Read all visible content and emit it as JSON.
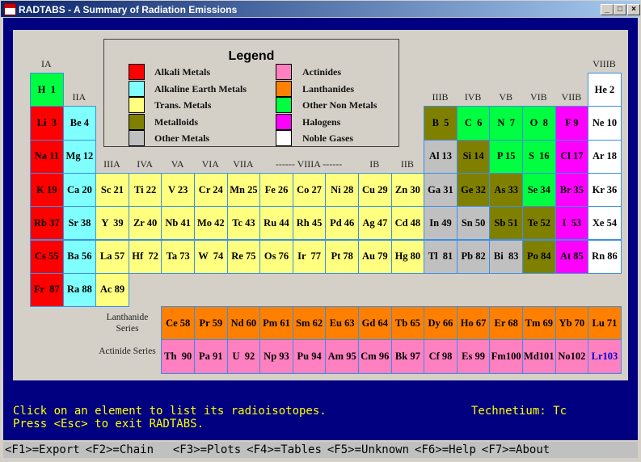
{
  "window": {
    "title": "RADTABS - A Summary of Radiation Emissions",
    "minimize": "_",
    "maximize": "□",
    "close": "×"
  },
  "colors": {
    "alkali": "#ff0000",
    "alkaline": "#80ffff",
    "trans": "#ffff80",
    "metalloid": "#808000",
    "other": "#c0c0c0",
    "noble": "#ffffff",
    "actinide": "#ff80c0",
    "lanthanide": "#ff8000",
    "nonmetal": "#00ff40",
    "halogen": "#ff00ff"
  },
  "legend": {
    "title": "Legend",
    "items": [
      {
        "label": "Alkali Metals",
        "cat": "alkali"
      },
      {
        "label": "Alkaline Earth Metals",
        "cat": "alkaline"
      },
      {
        "label": "Trans. Metals",
        "cat": "trans"
      },
      {
        "label": "Metalloids",
        "cat": "metalloid"
      },
      {
        "label": "Other Metals",
        "cat": "other"
      },
      {
        "label": "Actinides",
        "cat": "actinide"
      },
      {
        "label": "Lanthanides",
        "cat": "lanthanide"
      },
      {
        "label": "Other Non Metals",
        "cat": "nonmetal"
      },
      {
        "label": "Halogens",
        "cat": "halogen"
      },
      {
        "label": "Noble Gases",
        "cat": "noble"
      }
    ]
  },
  "groups": [
    "IA",
    "IIA",
    "IIIA",
    "IVA",
    "VA",
    "VIA",
    "VIIA",
    "------ VIIIA ------",
    "IB",
    "IIB",
    "IIIB",
    "IVB",
    "VB",
    "VIB",
    "VIIB",
    "VIIIB"
  ],
  "table": [
    [
      "H  1:nonmetal",
      "",
      "",
      "",
      "",
      "",
      "",
      "",
      "",
      "",
      "",
      "",
      "",
      "",
      "",
      "",
      "",
      "He 2:noble"
    ],
    [
      "Li  3:alkali",
      "Be 4:alkaline",
      "",
      "",
      "",
      "",
      "",
      "",
      "",
      "",
      "",
      "",
      "B  5:metalloid",
      "C  6:nonmetal",
      "N  7:nonmetal",
      "O  8:nonmetal",
      "F 9:halogen",
      "Ne 10:noble"
    ],
    [
      "Na 11:alkali",
      "Mg 12:alkaline",
      "",
      "",
      "",
      "",
      "",
      "",
      "",
      "",
      "",
      "",
      "Al 13:other",
      "Si 14:metalloid",
      "P 15:nonmetal",
      "S  16:nonmetal",
      "Cl 17:halogen",
      "Ar 18:noble"
    ],
    [
      "K 19:alkali",
      "Ca 20:alkaline",
      "Sc 21:trans",
      "Ti 22:trans",
      "V 23:trans",
      "Cr 24:trans",
      "Mn 25:trans",
      "Fe 26:trans",
      "Co 27:trans",
      "Ni 28:trans",
      "Cu 29:trans",
      "Zn 30:trans",
      "Ga 31:other",
      "Ge 32:metalloid",
      "As 33:metalloid",
      "Se 34:nonmetal",
      "Br 35:halogen",
      "Kr 36:noble"
    ],
    [
      "Rb 37:alkali",
      "Sr 38:alkaline",
      "Y  39:trans",
      "Zr 40:trans",
      "Nb 41:trans",
      "Mo 42:trans",
      "Tc 43:trans",
      "Ru 44:trans",
      "Rh 45:trans",
      "Pd 46:trans",
      "Ag 47:trans",
      "Cd 48:trans",
      "In 49:other",
      "Sn 50:other",
      "Sb 51:metalloid",
      "Te 52:metalloid",
      "I  53:halogen",
      "Xe 54:noble"
    ],
    [
      "Cs 55:alkali",
      "Ba 56:alkaline",
      "La 57:trans",
      "Hf  72:trans",
      "Ta 73:trans",
      "W  74:trans",
      "Re 75:trans",
      "Os 76:trans",
      "Ir  77:trans",
      "Pt 78:trans",
      "Au 79:trans",
      "Hg 80:trans",
      "Tl  81:other",
      "Pb 82:other",
      "Bi  83:other",
      "Po 84:metalloid",
      "At 85:halogen",
      "Rn 86:noble"
    ],
    [
      "Fr  87:alkali",
      "Ra 88:alkaline",
      "Ac 89:trans",
      "",
      "",
      "",
      "",
      "",
      "",
      "",
      "",
      "",
      "",
      "",
      "",
      "",
      "",
      ""
    ]
  ],
  "series": {
    "lanthanide_label": "Lanthanide Series",
    "actinide_label": "Actinide Series",
    "lanthanides": [
      "Ce 58",
      "Pr 59",
      "Nd 60",
      "Pm 61",
      "Sm 62",
      "Eu 63",
      "Gd 64",
      "Tb 65",
      "Dy 66",
      "Ho 67",
      "Er 68",
      "Tm 69",
      "Yb 70",
      "Lu 71"
    ],
    "actinides": [
      "Th  90",
      "Pa 91",
      "U  92",
      "Np 93",
      "Pu 94",
      "Am 95",
      "Cm 96",
      "Bk 97",
      "Cf 98",
      "Es 99",
      "Fm100",
      "Md101",
      "No102",
      "Lr103"
    ],
    "highlight": "Lr103",
    "highlight_color": "#0000cc"
  },
  "status": {
    "line1": "Click on an element to list its radioisotopes.",
    "line2": "Press <Esc> to exit RADTABS.",
    "selected": "Technetium: Tc"
  },
  "footer": [
    "<F1>=Export",
    "<F2>=Chain ",
    " <F3>=Plots",
    "<F4>=Tables",
    "<F5>=Unknown",
    "<F6>=Help",
    "<F7>=About"
  ]
}
